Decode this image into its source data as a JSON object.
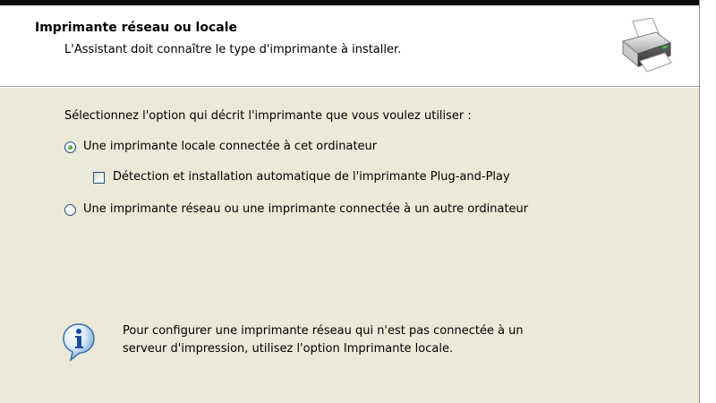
{
  "header": {
    "title": "Imprimante réseau ou locale",
    "subtitle": "L'Assistant doit connaître le type d'imprimante à installer.",
    "icon": "printer-icon"
  },
  "body": {
    "prompt": "Sélectionnez l'option qui décrit l'imprimante que vous voulez utiliser :",
    "options": [
      {
        "label": "Une imprimante locale connectée à cet ordinateur",
        "selected": true
      },
      {
        "label": "Une imprimante réseau ou une imprimante connectée à un autre ordinateur",
        "selected": false
      }
    ],
    "checkbox": {
      "label": "Détection et installation automatique de l'imprimante Plug-and-Play",
      "checked": false
    },
    "info": {
      "icon": "info-icon",
      "line1": "Pour configurer une imprimante réseau qui n'est pas connectée à un",
      "line2": "serveur d'impression, utilisez l'option Imprimante locale."
    }
  },
  "colors": {
    "body_background": "#ece9d8",
    "header_background": "#ffffff",
    "radio_dot": "#21a121",
    "control_border": "#1c5180"
  }
}
